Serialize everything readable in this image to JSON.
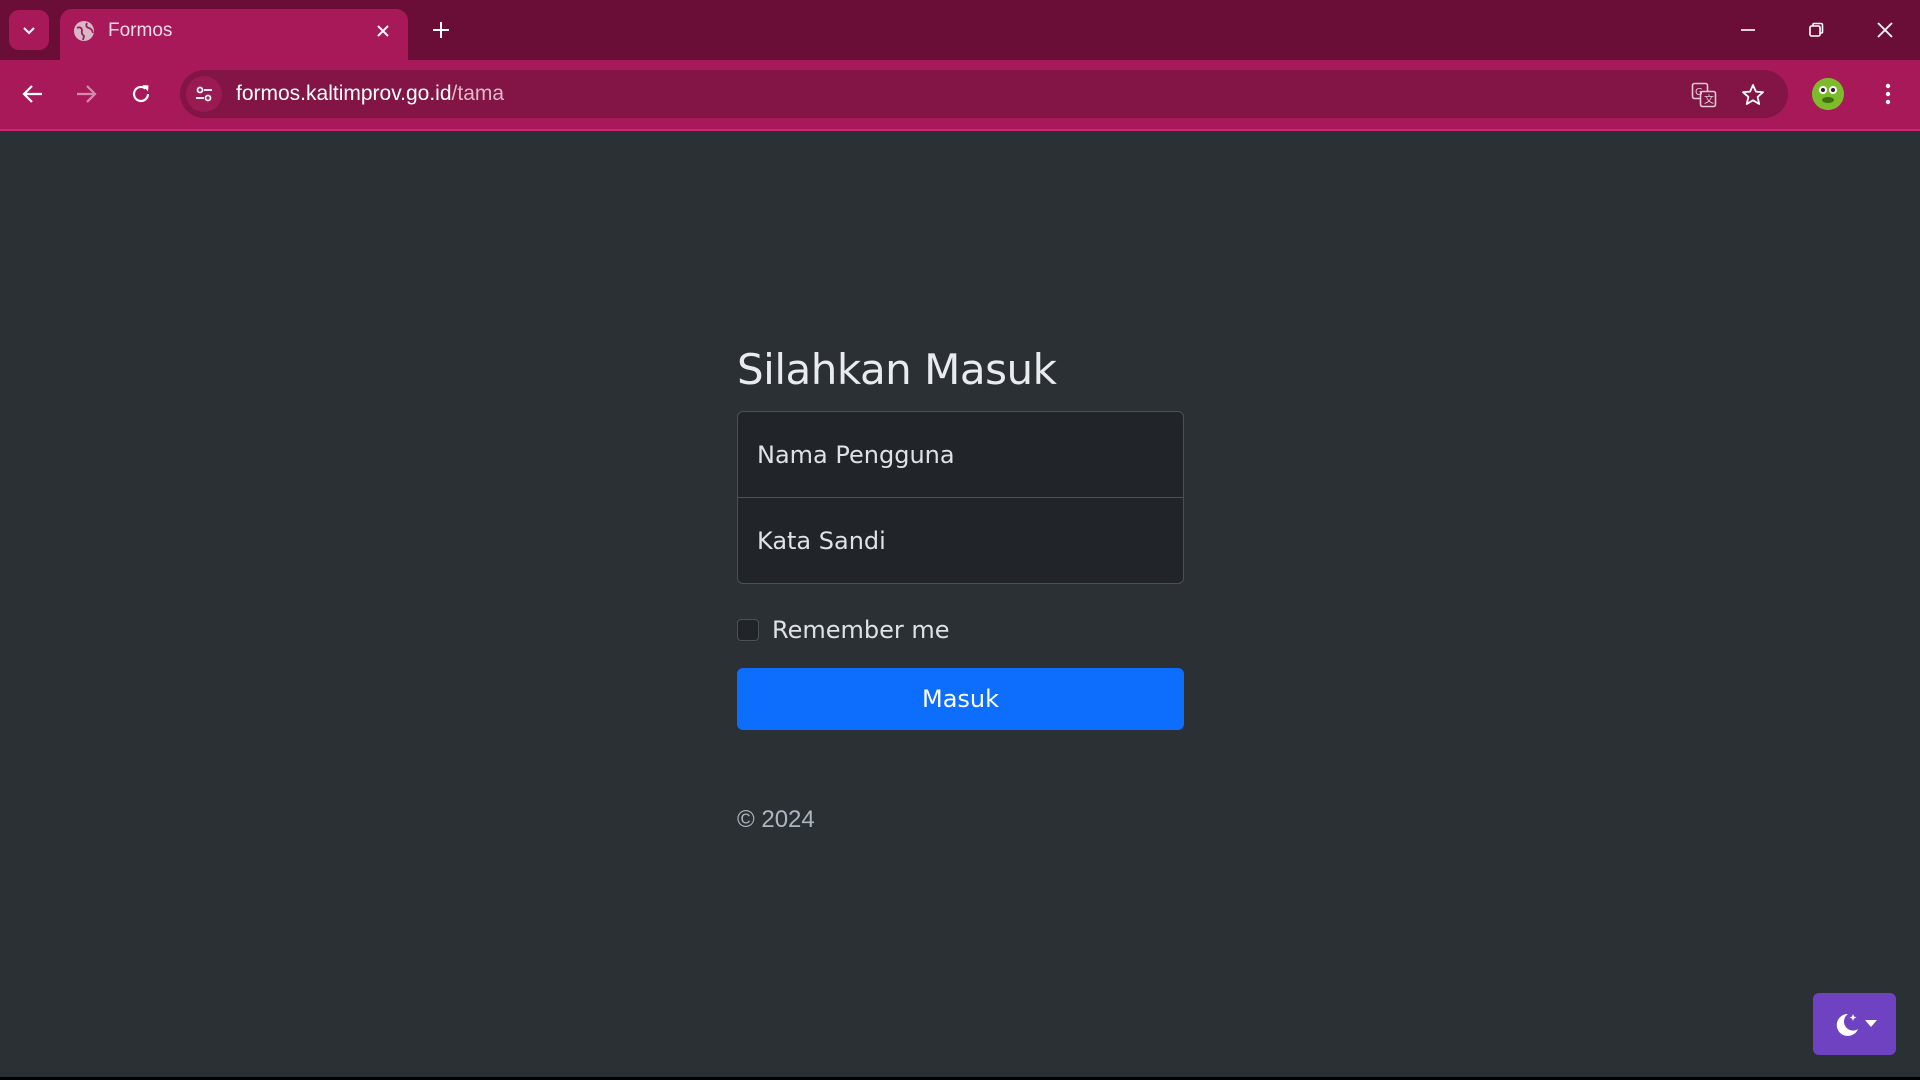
{
  "browser": {
    "tab": {
      "title": "Formos"
    },
    "address": {
      "host": "formos.kaltimprov.go.id",
      "path": "/tama"
    },
    "colors": {
      "frame": "#6a0e38",
      "toolbar": "#a8195a",
      "omnibox": "#821545"
    }
  },
  "login": {
    "heading": "Silahkan Masuk",
    "username": {
      "placeholder": "Nama Pengguna",
      "value": ""
    },
    "password": {
      "placeholder": "Kata Sandi",
      "value": ""
    },
    "remember_label": "Remember me",
    "remember_checked": false,
    "submit_label": "Masuk"
  },
  "footer": {
    "copyright": "© 2024"
  },
  "theme_toggle": {
    "icon": "moon-stars-icon",
    "caret": "caret-down-icon",
    "color": "#6f42c1"
  },
  "page_colors": {
    "background": "#2b3035",
    "primary": "#0d6efd"
  }
}
